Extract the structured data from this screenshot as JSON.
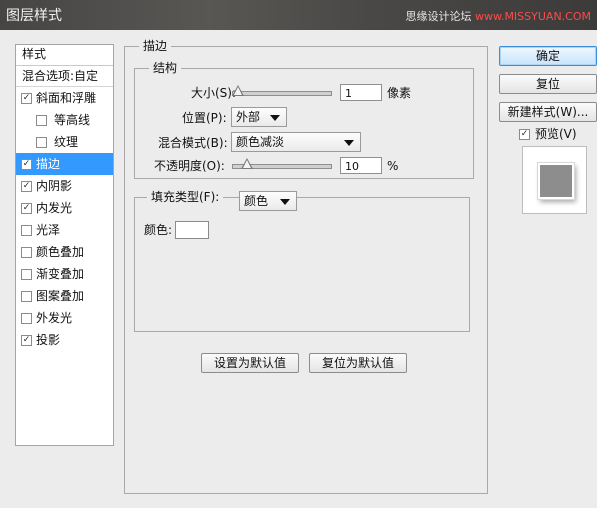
{
  "window": {
    "title": "图层样式",
    "watermark_prefix": "思缘设计论坛 ",
    "watermark_host": "www.MISSYUAN.COM"
  },
  "sidebar": {
    "header": "样式",
    "blend_options": "混合选项:自定",
    "items": [
      {
        "label": "斜面和浮雕",
        "checked": true,
        "indent": 0,
        "selected": false
      },
      {
        "label": "等高线",
        "checked": false,
        "indent": 1,
        "selected": false
      },
      {
        "label": "纹理",
        "checked": false,
        "indent": 1,
        "selected": false
      },
      {
        "label": "描边",
        "checked": true,
        "indent": 0,
        "selected": true
      },
      {
        "label": "内阴影",
        "checked": true,
        "indent": 0,
        "selected": false
      },
      {
        "label": "内发光",
        "checked": true,
        "indent": 0,
        "selected": false
      },
      {
        "label": "光泽",
        "checked": false,
        "indent": 0,
        "selected": false
      },
      {
        "label": "颜色叠加",
        "checked": false,
        "indent": 0,
        "selected": false
      },
      {
        "label": "渐变叠加",
        "checked": false,
        "indent": 0,
        "selected": false
      },
      {
        "label": "图案叠加",
        "checked": false,
        "indent": 0,
        "selected": false
      },
      {
        "label": "外发光",
        "checked": false,
        "indent": 0,
        "selected": false
      },
      {
        "label": "投影",
        "checked": true,
        "indent": 0,
        "selected": false
      }
    ]
  },
  "stroke": {
    "legend": "描边",
    "structure": {
      "legend": "结构",
      "size_label": "大小(S):",
      "size_value": "1",
      "size_unit": "像素",
      "size_slider_fraction": 0.0,
      "position_label": "位置(P):",
      "position_value": "外部",
      "blend_mode_label": "混合模式(B):",
      "blend_mode_value": "颜色减淡",
      "opacity_label": "不透明度(O):",
      "opacity_value": "10",
      "opacity_unit": "%",
      "opacity_slider_fraction": 0.1
    },
    "fill": {
      "fill_type_label": "填充类型(F):",
      "fill_type_value": "颜色",
      "color_label": "颜色:",
      "color_value": "#ffffff"
    },
    "set_default_label": "设置为默认值",
    "reset_default_label": "复位为默认值"
  },
  "actions": {
    "ok_label": "确定",
    "reset_label": "复位",
    "new_style_label": "新建样式(W)...",
    "preview_label": "预览(V)",
    "preview_checked": true
  },
  "colors": {
    "selection": "#3399ff",
    "titlebar": "#4a4947"
  }
}
